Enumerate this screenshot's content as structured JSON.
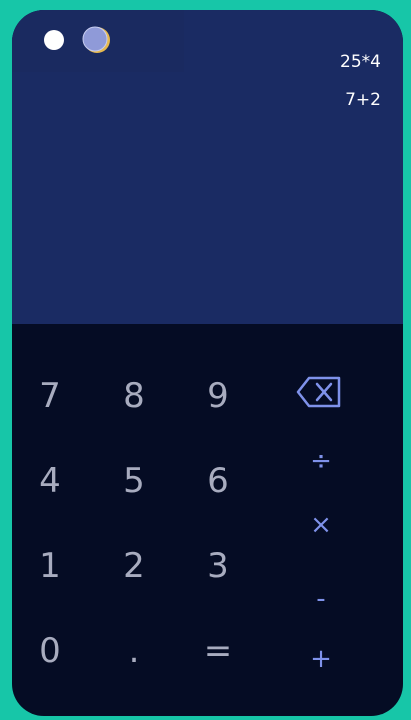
{
  "theme": {
    "light_icon": "sun-circle-icon",
    "dark_icon": "moon-icon"
  },
  "history": [
    "25*4",
    "7+2"
  ],
  "keys": {
    "digits": [
      "7",
      "8",
      "9",
      "4",
      "5",
      "6",
      "1",
      "2",
      "3",
      "0"
    ],
    "decimal": ".",
    "equals": "="
  },
  "operators": {
    "backspace_icon": "backspace-icon",
    "divide": "÷",
    "multiply": "×",
    "subtract": "-",
    "add": "+"
  },
  "colors": {
    "background": "#17c6a8",
    "display": "#1a2b63",
    "keypad": "#050c24",
    "digit_text": "#a8acbf",
    "operator_text": "#7f92ea"
  }
}
